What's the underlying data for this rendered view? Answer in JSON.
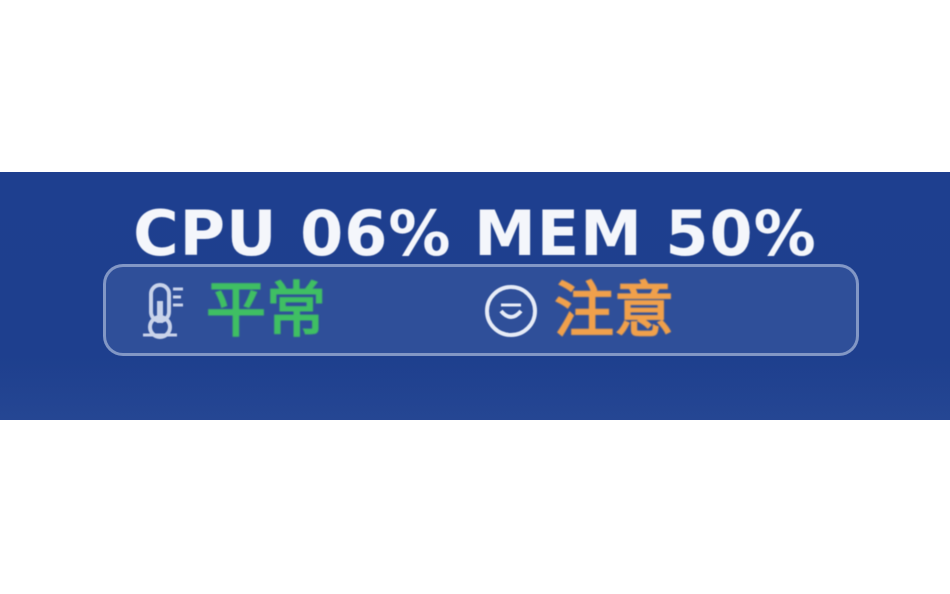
{
  "monitor": {
    "cpu_label": "CPU",
    "cpu_value": "06%",
    "mem_label": "MEM",
    "mem_value": "50%"
  },
  "status": {
    "left": {
      "icon": "thermometer-icon",
      "label": "平常"
    },
    "right": {
      "icon": "smile-face-icon",
      "label": "注意"
    }
  },
  "colors": {
    "background": "#1e3f8f",
    "text": "#f4f6fb",
    "normal": "#3fbf63",
    "caution": "#f0a04b"
  }
}
